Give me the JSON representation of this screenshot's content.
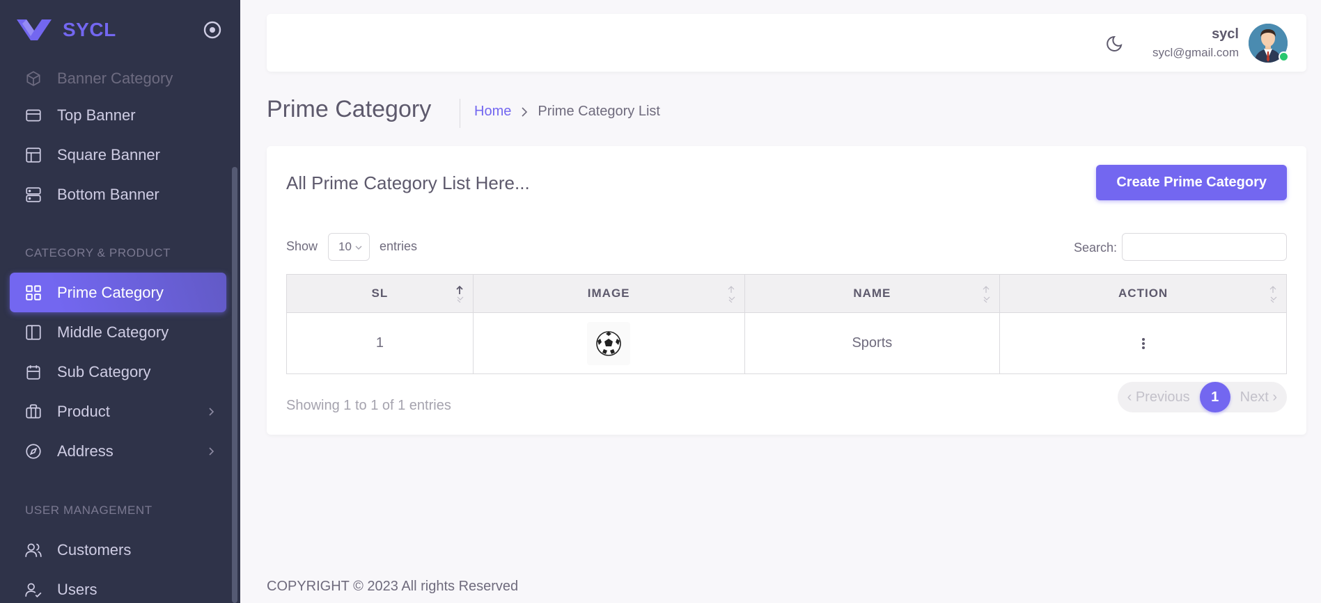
{
  "brand": {
    "name": "SYCL"
  },
  "sidebar": {
    "items_top": [
      {
        "label": "Banner Category",
        "icon": "box-icon"
      },
      {
        "label": "Top Banner",
        "icon": "credit-card-icon"
      },
      {
        "label": "Square Banner",
        "icon": "layout-icon"
      },
      {
        "label": "Bottom Banner",
        "icon": "server-icon"
      }
    ],
    "section_category": "CATEGORY & PRODUCT",
    "items_category": [
      {
        "label": "Prime Category",
        "icon": "grid-icon",
        "active": true
      },
      {
        "label": "Middle Category",
        "icon": "columns-icon"
      },
      {
        "label": "Sub Category",
        "icon": "calendar-icon"
      },
      {
        "label": "Product",
        "icon": "briefcase-icon",
        "has_children": true
      },
      {
        "label": "Address",
        "icon": "compass-icon",
        "has_children": true
      }
    ],
    "section_users": "USER MANAGEMENT",
    "items_users": [
      {
        "label": "Customers",
        "icon": "users-icon"
      },
      {
        "label": "Users",
        "icon": "user-check-icon"
      }
    ]
  },
  "navbar": {
    "user_name": "sycl",
    "user_email": "sycl@gmail.com",
    "status_color": "#28c76f"
  },
  "page": {
    "title": "Prime Category",
    "breadcrumb_home": "Home",
    "breadcrumb_current": "Prime Category List"
  },
  "card": {
    "title": "All Prime Category List Here...",
    "create_button": "Create Prime Category",
    "show_label": "Show",
    "entries_label": "entries",
    "page_length": "10",
    "search_label": "Search:",
    "search_value": ""
  },
  "table": {
    "headers": [
      "SL",
      "IMAGE",
      "NAME",
      "ACTION"
    ],
    "rows": [
      {
        "sl": "1",
        "image": "soccer-ball-image",
        "name": "Sports"
      }
    ]
  },
  "pagination": {
    "info": "Showing 1 to 1 of 1 entries",
    "previous": "‹ Previous",
    "current": "1",
    "next": "Next ›"
  },
  "footer": {
    "text": "COPYRIGHT © 2023 All rights Reserved"
  },
  "colors": {
    "accent": "#7367f0",
    "sidebar_bg": "#2f3349",
    "page_bg": "#f8f7fa"
  }
}
